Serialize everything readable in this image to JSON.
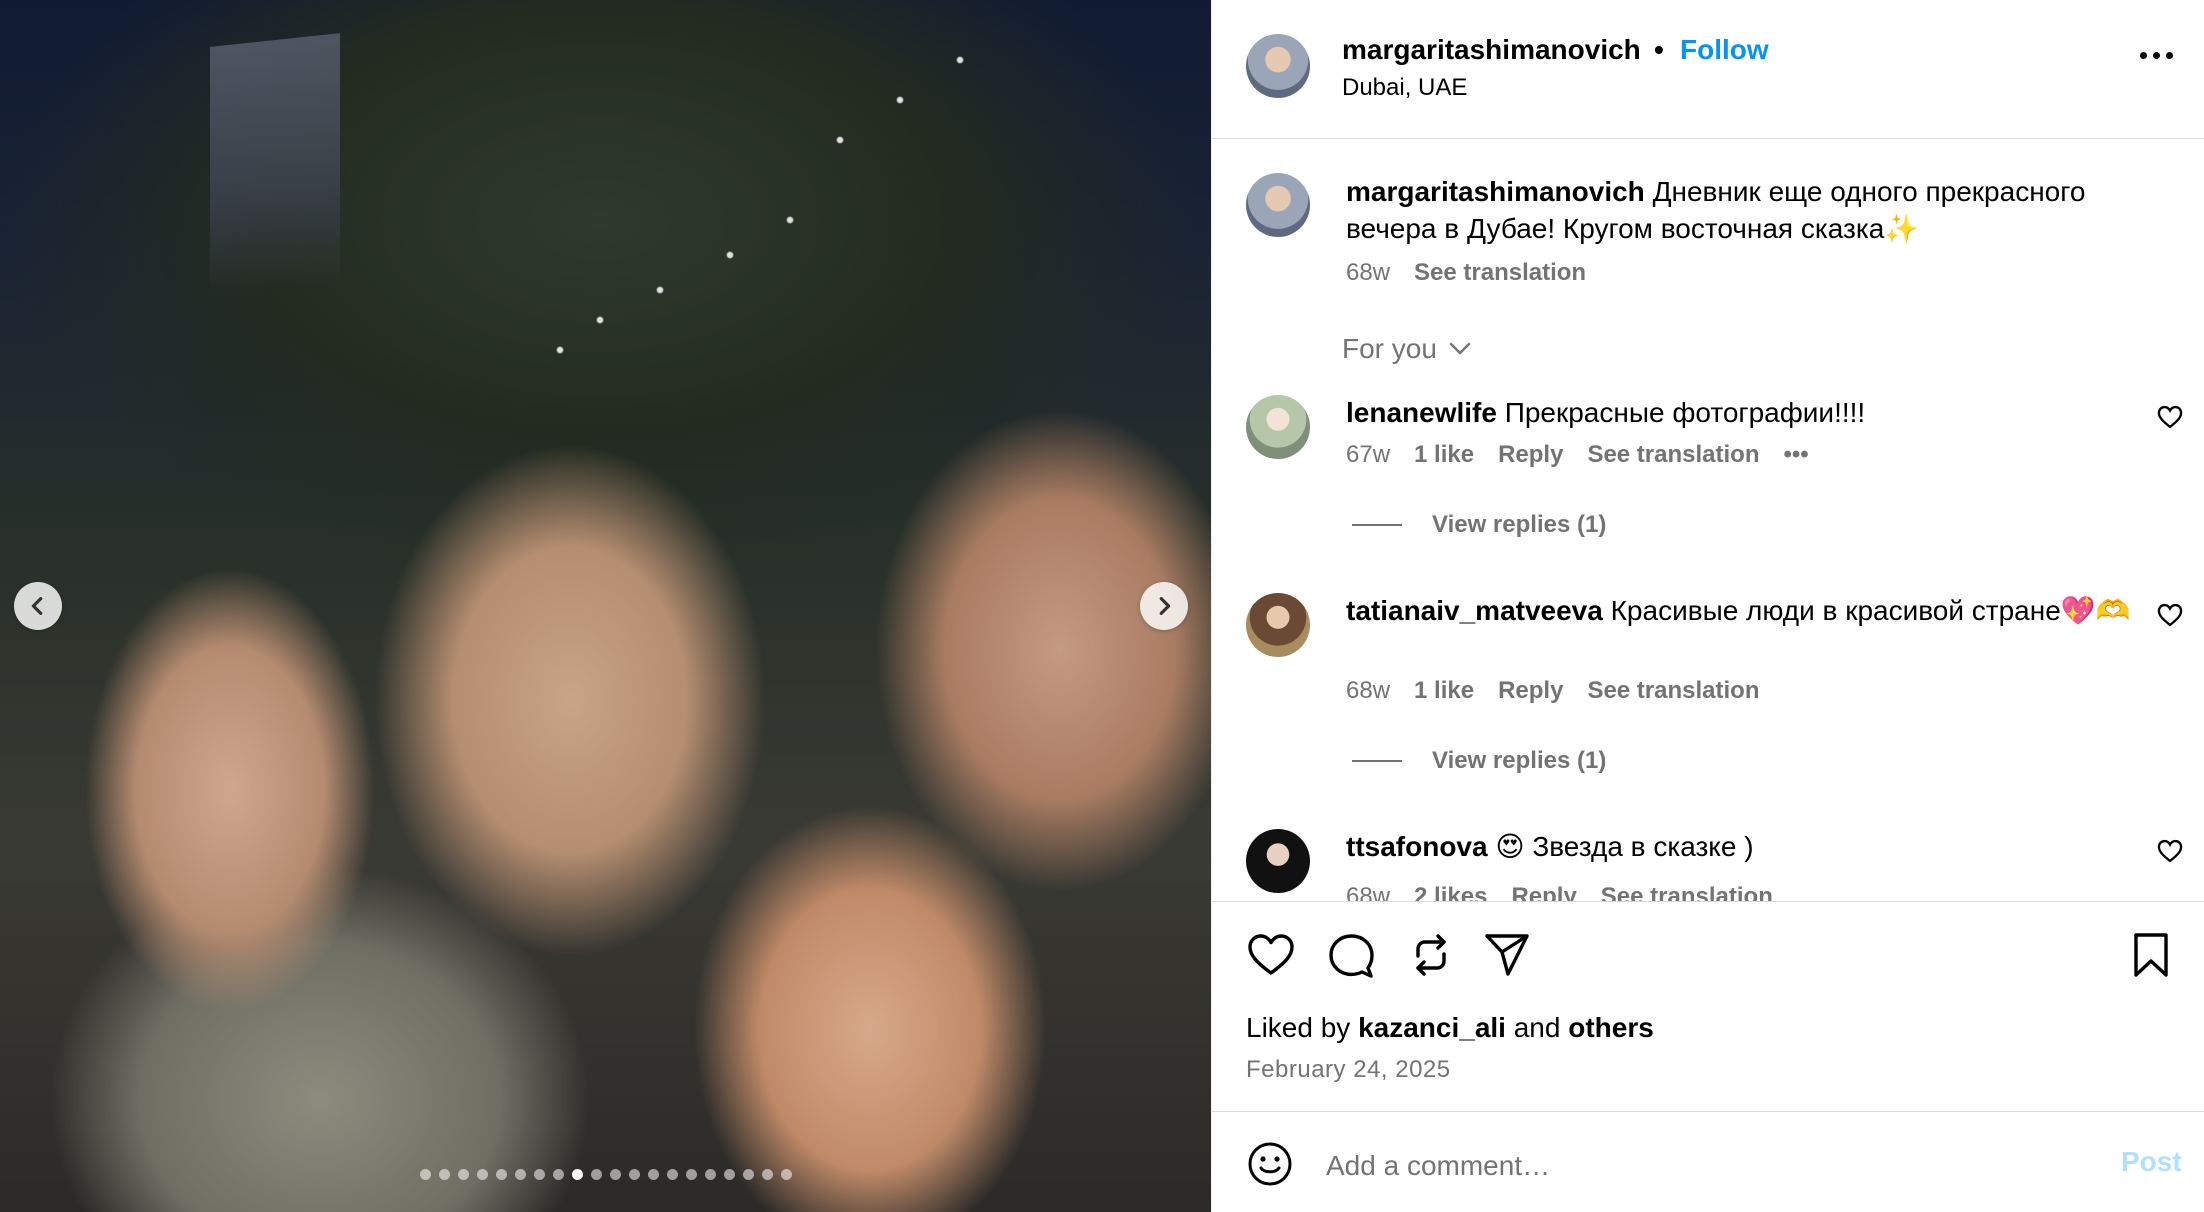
{
  "post": {
    "username": "margaritashimanovich",
    "separator": "•",
    "follow_label": "Follow",
    "location": "Dubai, UAE",
    "more_icon": "more-horizontal-icon",
    "photo": {
      "slide_count": 20,
      "active_slide_index": 8,
      "prev_icon": "chevron-left-icon",
      "next_icon": "chevron-right-icon"
    }
  },
  "caption": {
    "username": "margaritashimanovich",
    "text": "Дневник еще одного прекрасного вечера в Дубае! Кругом восточная сказка✨",
    "age": "68w",
    "see_translation": "See translation"
  },
  "comments_filter": {
    "label": "For you",
    "icon": "chevron-down-icon"
  },
  "comments": [
    {
      "username": "lenanewlife",
      "text": "Прекрасные фотографии!!!!",
      "age": "67w",
      "likes": "1 like",
      "reply": "Reply",
      "see_translation": "See translation",
      "more": "•••",
      "view_replies": "View replies (1)"
    },
    {
      "username": "tatianaiv_matveeva",
      "text": "Красивые люди в красивой стране💖🫶",
      "age": "68w",
      "likes": "1 like",
      "reply": "Reply",
      "see_translation": "See translation",
      "view_replies": "View replies (1)"
    },
    {
      "username": "ttsafonova",
      "text": "😍 Звезда в сказке )",
      "age": "68w",
      "likes": "2 likes",
      "reply": "Reply",
      "see_translation": "See translation"
    }
  ],
  "actions": {
    "like_icon": "heart-icon",
    "comment_icon": "comment-icon",
    "repost_icon": "repost-icon",
    "share_icon": "send-icon",
    "save_icon": "bookmark-icon"
  },
  "likes": {
    "prefix": "Liked by",
    "user": "kazanci_ali",
    "conjunction": "and",
    "others": "others"
  },
  "date": "February 24, 2025",
  "add_comment": {
    "placeholder": "Add a comment…",
    "post_label": "Post",
    "emoji_icon": "emoji-icon"
  },
  "colors": {
    "accent": "#0095f6",
    "muted": "#737373",
    "post_disabled": "#b2dffc"
  }
}
